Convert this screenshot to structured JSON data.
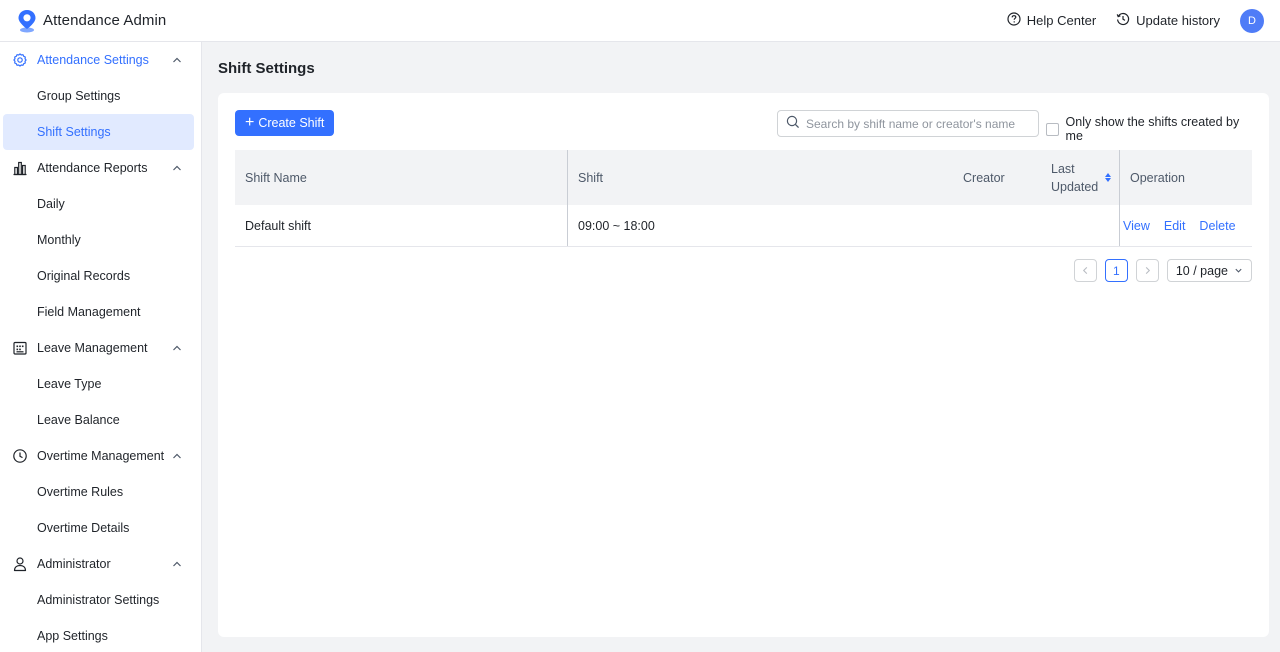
{
  "header": {
    "app_title": "Attendance Admin",
    "help_center": "Help Center",
    "update_history": "Update history",
    "avatar_initial": "D"
  },
  "sidebar": {
    "groups": [
      {
        "label": "Attendance Settings",
        "icon": "gear-icon",
        "active": true,
        "items": [
          {
            "label": "Group Settings"
          },
          {
            "label": "Shift Settings",
            "active": true
          }
        ]
      },
      {
        "label": "Attendance Reports",
        "icon": "bar-chart-icon",
        "items": [
          {
            "label": "Daily"
          },
          {
            "label": "Monthly"
          },
          {
            "label": "Original Records"
          },
          {
            "label": "Field Management"
          }
        ]
      },
      {
        "label": "Leave Management",
        "icon": "calendar-icon",
        "items": [
          {
            "label": "Leave Type"
          },
          {
            "label": "Leave Balance"
          }
        ]
      },
      {
        "label": "Overtime Management",
        "icon": "clock-icon",
        "items": [
          {
            "label": "Overtime Rules"
          },
          {
            "label": "Overtime Details"
          }
        ]
      },
      {
        "label": "Administrator",
        "icon": "user-icon",
        "items": [
          {
            "label": "Administrator Settings"
          },
          {
            "label": "App Settings"
          }
        ]
      }
    ]
  },
  "main": {
    "page_title": "Shift Settings",
    "create_button": "Create Shift",
    "search_placeholder": "Search by shift name or creator's name",
    "only_mine_label": "Only show the shifts created by me",
    "table": {
      "columns": [
        "Shift Name",
        "Shift",
        "Creator",
        "Last Updated",
        "Operation"
      ],
      "rows": [
        {
          "name": "Default shift",
          "shift": "09:00 ~ 18:00",
          "creator": "",
          "updated": "",
          "actions": [
            "View",
            "Edit",
            "Delete"
          ]
        }
      ]
    },
    "pagination": {
      "current_page": "1",
      "page_size": "10 / page"
    }
  },
  "colors": {
    "accent": "#3370ff",
    "active_bg": "#e1eaff"
  }
}
